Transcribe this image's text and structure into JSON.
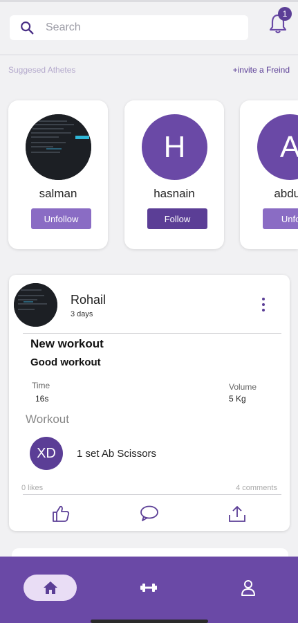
{
  "search": {
    "placeholder": "Search"
  },
  "notifications": {
    "count": "1"
  },
  "suggested": {
    "title": "Suggesed Athetes",
    "invite_label": "+invite a Freind",
    "athletes": [
      {
        "name": "salman",
        "initial": "",
        "button": "Unfollow",
        "avatar": "photo"
      },
      {
        "name": "hasnain",
        "initial": "H",
        "button": "Follow",
        "avatar": "letter"
      },
      {
        "name": "abdull",
        "initial": "A",
        "button": "Unfoll",
        "avatar": "letter"
      }
    ]
  },
  "post": {
    "user": "Rohail",
    "time": "3 days",
    "title": "New workout",
    "description": "Good workout",
    "time_label": "Time",
    "time_value": "16s",
    "volume_label": "Volume",
    "volume_value": "5 Kg",
    "workout_label": "Workout",
    "exercise": {
      "initials": "XD",
      "name": "1 set Ab Scissors"
    },
    "likes": "0 likes",
    "comments": "4 comments"
  },
  "colors": {
    "accent": "#5b3e96",
    "accent_light": "#8a6cc4",
    "nav_bg": "#6a49a6",
    "nav_active": "#e9ddf5"
  },
  "nav": {
    "items": [
      "home-icon",
      "dumbbell-icon",
      "profile-icon"
    ]
  }
}
